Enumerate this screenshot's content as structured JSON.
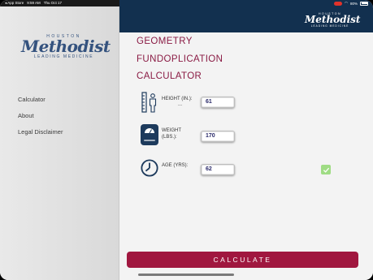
{
  "status": {
    "back_app": "◂ App Store",
    "time": "9:59 AM",
    "date": "Thu Oct 17",
    "battery": "80%"
  },
  "brand": {
    "houston": "HOUSTON",
    "name": "Methodist",
    "tagline": "LEADING MEDICINE"
  },
  "sidebar": {
    "items": [
      {
        "label": "Calculator"
      },
      {
        "label": "About"
      },
      {
        "label": "Legal Disclaimer"
      }
    ]
  },
  "main": {
    "title_lines": [
      "GEOMETRY",
      "FUNDOPLICATION",
      "CALCULATOR"
    ],
    "height": {
      "label": "HEIGHT (IN.):",
      "value": "61",
      "icon": "height-measure-icon"
    },
    "weight": {
      "label_1": "WEIGHT",
      "label_2": "(LBS.):",
      "value": "170",
      "icon": "scale-icon"
    },
    "age": {
      "label": "AGE (YRS):",
      "value": "62",
      "icon": "clock-icon"
    },
    "checkbox_checked": true,
    "calculate_label": "CALCULATE"
  },
  "colors": {
    "header": "#12304f",
    "title": "#8a1b44",
    "button": "#a0173f",
    "checkbox": "#9fdc84"
  }
}
